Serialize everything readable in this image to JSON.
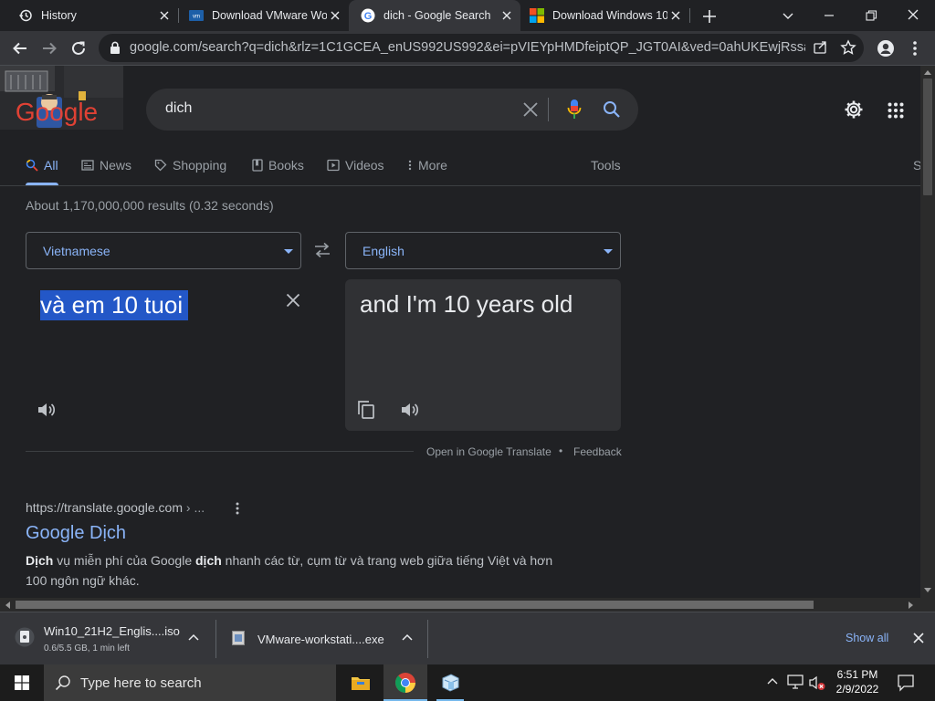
{
  "tabs": [
    {
      "title": "History",
      "favicon": "history-icon"
    },
    {
      "title": "Download VMware Wo",
      "favicon": "vmware-icon"
    },
    {
      "title": "dich - Google Search",
      "favicon": "google-icon",
      "active": true
    },
    {
      "title": "Download Windows 10",
      "favicon": "windows-icon"
    }
  ],
  "toolbar": {
    "url": "google.com/search?q=dich&rlz=1C1GCEA_enUS992US992&ei=pVIEYpHMDfeiptQP_JGT0AI&ved=0ahUKEwjRssaw5_P..."
  },
  "search": {
    "logo_text": "Google",
    "query": "dich"
  },
  "nav": {
    "tabs": [
      "All",
      "News",
      "Shopping",
      "Books",
      "Videos",
      "More"
    ],
    "tools": "Tools",
    "cut_label": "S"
  },
  "results": {
    "stats": "About 1,170,000,000 results (0.32 seconds)"
  },
  "translate": {
    "source_lang": "Vietnamese",
    "target_lang": "English",
    "source_text": "và em 10 tuoi",
    "target_text": "and I'm 10 years old",
    "open_link": "Open in Google Translate",
    "dot": "•",
    "feedback": "Feedback"
  },
  "result1": {
    "url": "https://translate.google.com",
    "url_suffix": " › ...",
    "title": "Google Dịch",
    "snippet_b1": "Dịch",
    "snippet_t1": " vụ miễn phí của Google ",
    "snippet_b2": "dịch",
    "snippet_t2": " nhanh các từ, cụm từ và trang web giữa tiếng Việt và hơn",
    "snippet_line2": "100 ngôn ngữ khác."
  },
  "downloads": {
    "items": [
      {
        "name": "Win10_21H2_Englis....iso",
        "status": "0.6/5.5 GB, 1 min left"
      },
      {
        "name": "VMware-workstati....exe",
        "status": ""
      }
    ],
    "show_all": "Show all"
  },
  "taskbar": {
    "search_placeholder": "Type here to search",
    "time": "6:51 PM",
    "date": "2/9/2022"
  },
  "colors": {
    "accent": "#8ab4f8",
    "page_bg": "#202124",
    "highlight": "#2357c7"
  }
}
